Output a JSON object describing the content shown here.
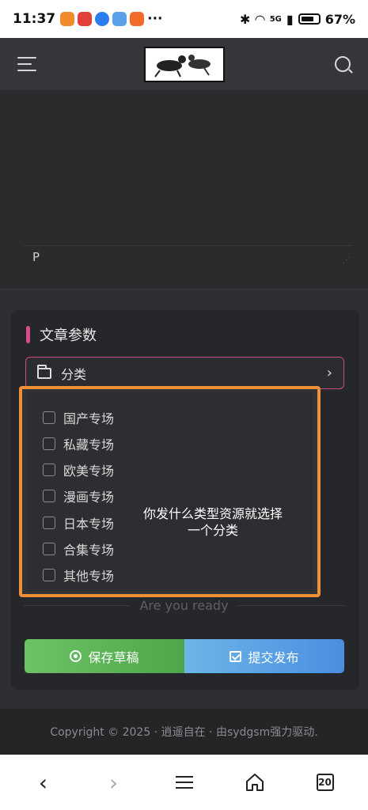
{
  "status_bar": {
    "time": "11:37",
    "more": "···",
    "battery": "67%",
    "network": "5G"
  },
  "header": {
    "menu_icon": "menu-icon",
    "search_icon": "search-icon"
  },
  "editor": {
    "current_block": "P"
  },
  "params": {
    "title": "文章参数",
    "category_label": "分类",
    "accent": "#d94c8b"
  },
  "dropdown": {
    "highlight_color": "#f0913a",
    "items": [
      "国产专场",
      "私藏专场",
      "欧美专场",
      "漫画专场",
      "日本专场",
      "合集专场",
      "其他专场"
    ],
    "hint_line1": "你发什么类型资源就选择",
    "hint_line2": "一个分类"
  },
  "actions": {
    "ready_text": "Are you ready",
    "save_label": "保存草稿",
    "submit_label": "提交发布"
  },
  "footer": {
    "copyright": "Copyright © 2025 · 逍遥自在 · 由sydgsm强力驱动."
  },
  "browser_nav": {
    "tabs_count": "20"
  }
}
